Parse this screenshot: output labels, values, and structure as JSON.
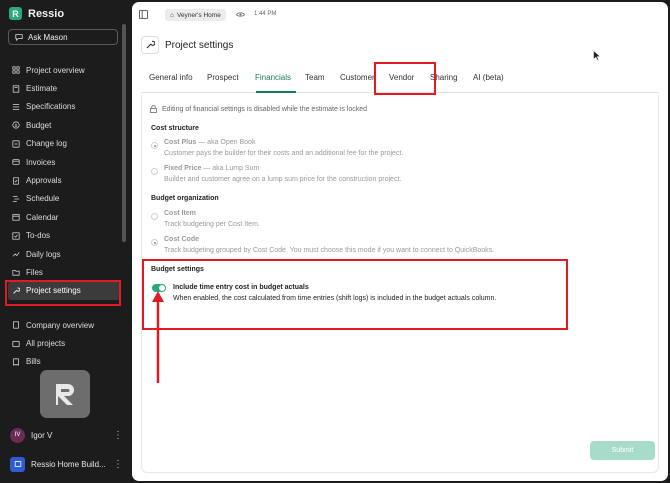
{
  "app": {
    "brand": "Ressio",
    "ask_label": "Ask Mason"
  },
  "sidebar": {
    "items": [
      {
        "label": "Project overview",
        "icon": "grid-icon"
      },
      {
        "label": "Estimate",
        "icon": "calculator-icon"
      },
      {
        "label": "Specifications",
        "icon": "list-icon"
      },
      {
        "label": "Budget",
        "icon": "dollar-icon"
      },
      {
        "label": "Change log",
        "icon": "change-log-icon"
      },
      {
        "label": "Invoices",
        "icon": "invoice-icon"
      },
      {
        "label": "Approvals",
        "icon": "approval-icon"
      },
      {
        "label": "Schedule",
        "icon": "schedule-icon"
      },
      {
        "label": "Calendar",
        "icon": "calendar-icon"
      },
      {
        "label": "To-dos",
        "icon": "checklist-icon"
      },
      {
        "label": "Daily logs",
        "icon": "daily-logs-icon"
      },
      {
        "label": "Files",
        "icon": "folder-icon"
      },
      {
        "label": "Project settings",
        "icon": "wrench-icon",
        "active": true
      }
    ],
    "secondary": [
      {
        "label": "Company overview",
        "icon": "building-icon"
      },
      {
        "label": "All projects",
        "icon": "projects-icon"
      },
      {
        "label": "Bills",
        "icon": "bills-icon"
      }
    ],
    "user": {
      "initials": "IV",
      "name": "Igor V"
    },
    "org": {
      "name": "Ressio Home Build..."
    }
  },
  "topbar": {
    "workspace": "Veyner's Home",
    "time": "1:44 PM"
  },
  "page": {
    "title": "Project settings",
    "tabs": [
      "General info",
      "Prospect",
      "Financials",
      "Team",
      "Customer",
      "Vendor",
      "Sharing",
      "AI (beta)"
    ],
    "active_tab": "Financials",
    "lock_note": "Editing of financial settings is disabled while the estimate is locked",
    "cost_structure": {
      "heading": "Cost structure",
      "options": [
        {
          "title": "Cost Plus",
          "aka": " — aka Open Book",
          "desc": "Customer pays the builder for their costs and an additional fee for the project.",
          "selected": true
        },
        {
          "title": "Fixed Price",
          "aka": " — aka Lump Sum",
          "desc": "Builder and customer agree on a lump sum price for the construction project.",
          "selected": false
        }
      ]
    },
    "budget_org": {
      "heading": "Budget organization",
      "options": [
        {
          "title": "Cost Item",
          "desc": "Track budgeting per Cost Item.",
          "selected": false
        },
        {
          "title": "Cost Code",
          "desc": "Track budgeting grouped by Cost Code. You must choose this mode if you want to connect to QuickBooks.",
          "selected": true
        }
      ]
    },
    "budget_settings": {
      "heading": "Budget settings",
      "toggle_title": "Include time entry cost in budget actuals",
      "toggle_desc": "When enabled, the cost calculated from time entries (shift logs) is included in the budget actuals column.",
      "toggle_on": true
    },
    "submit_label": "Submit"
  },
  "colors": {
    "accent": "#1b7a5a",
    "toggle": "#2aa87e",
    "highlight": "#e01b22",
    "sidebar_bg": "#1c1c1c"
  }
}
